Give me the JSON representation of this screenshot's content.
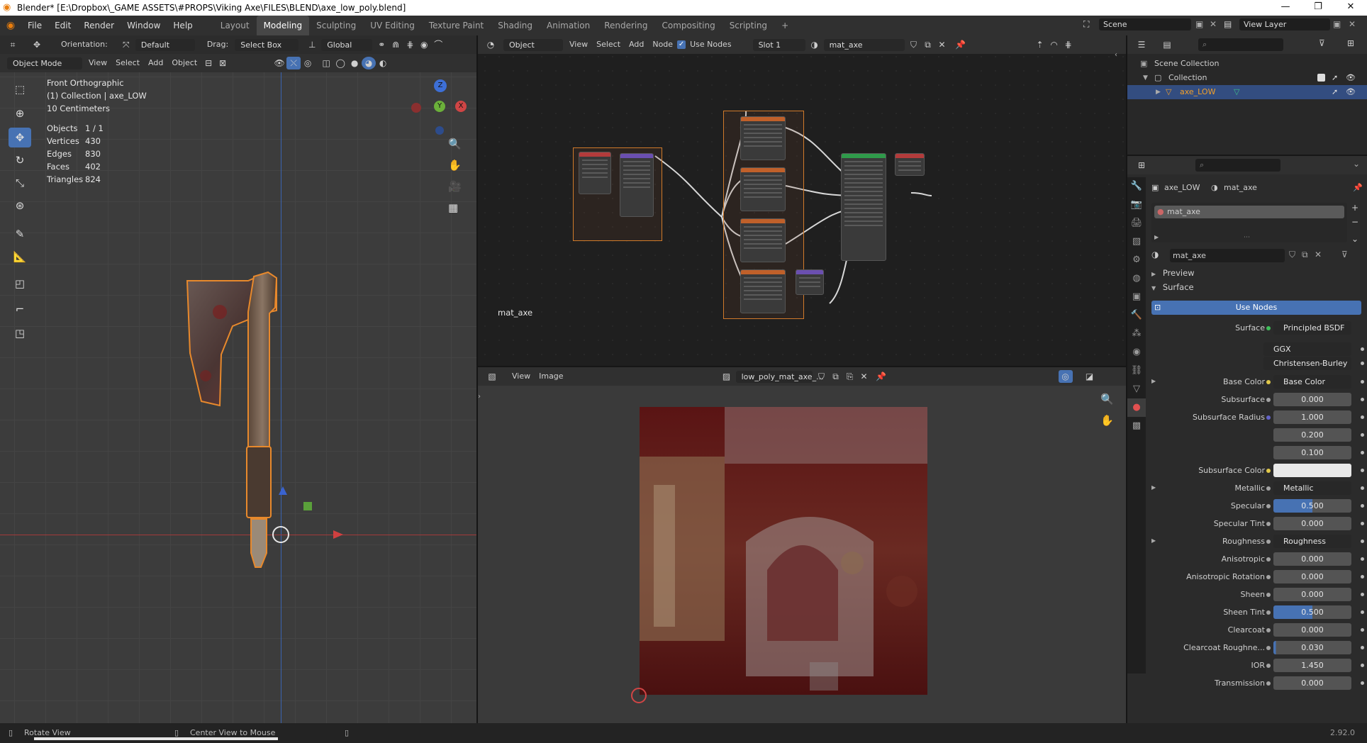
{
  "window": {
    "title": "Blender* [E:\\Dropbox\\_GAME ASSETS\\#PROPS\\Viking Axe\\FILES\\BLEND\\axe_low_poly.blend]",
    "minimize": "—",
    "maximize": "❐",
    "close": "✕"
  },
  "menu": {
    "items": [
      "File",
      "Edit",
      "Render",
      "Window",
      "Help"
    ]
  },
  "workspaces": {
    "tabs": [
      "Layout",
      "Modeling",
      "Sculpting",
      "UV Editing",
      "Texture Paint",
      "Shading",
      "Animation",
      "Rendering",
      "Compositing",
      "Scripting"
    ],
    "active": "Modeling",
    "add": "+"
  },
  "scene": {
    "name": "Scene",
    "view_layer": "View Layer"
  },
  "viewport": {
    "header": {
      "orientation_label": "Orientation:",
      "orientation_value": "Default",
      "drag_label": "Drag:",
      "drag_value": "Select Box",
      "transform_space": "Global",
      "mode": "Object Mode",
      "menus": [
        "View",
        "Select",
        "Add",
        "Object"
      ]
    },
    "overlay": {
      "view_name": "Front Orthographic",
      "collection_line": "(1) Collection | axe_LOW",
      "scale": "10 Centimeters",
      "stats": [
        {
          "label": "Objects",
          "value": "1 / 1"
        },
        {
          "label": "Vertices",
          "value": "430"
        },
        {
          "label": "Edges",
          "value": "830"
        },
        {
          "label": "Faces",
          "value": "402"
        },
        {
          "label": "Triangles",
          "value": "824"
        }
      ]
    },
    "gizmo": {
      "z": "Z",
      "y": "Y",
      "x": "X"
    },
    "tools": [
      "select-box",
      "cursor",
      "move",
      "rotate",
      "scale",
      "transform",
      "annotate",
      "measure",
      "add-cube",
      "extrude",
      "shrink"
    ]
  },
  "node_editor": {
    "header": {
      "type": "Object",
      "menus": [
        "View",
        "Select",
        "Add",
        "Node"
      ],
      "use_nodes_label": "Use Nodes",
      "use_nodes_checked": true,
      "slot": "Slot 1",
      "material": "mat_axe"
    },
    "material_label": "mat_axe"
  },
  "image_editor": {
    "header": {
      "menus": [
        "View",
        "Image"
      ],
      "image_name": "low_poly_mat_axe_..."
    }
  },
  "outliner": {
    "search_placeholder": "",
    "rows": [
      {
        "label": "Scene Collection",
        "indent": 0,
        "selected": false
      },
      {
        "label": "Collection",
        "indent": 1,
        "selected": false
      },
      {
        "label": "axe_LOW",
        "indent": 2,
        "selected": true
      }
    ]
  },
  "properties": {
    "breadcrumb_object": "axe_LOW",
    "breadcrumb_material": "mat_axe",
    "slot_item": "mat_axe",
    "material_name": "mat_axe",
    "panels": {
      "preview": "Preview",
      "surface": "Surface"
    },
    "use_nodes_button": "Use Nodes",
    "surface_label": "Surface",
    "surface_value": "Principled BSDF",
    "distribution": "GGX",
    "subsurface_method": "Christensen-Burley",
    "rows": [
      {
        "label": "Base Color",
        "value": "Base Color",
        "kind": "link",
        "dot": "#e1c84a",
        "expand": true
      },
      {
        "label": "Subsurface",
        "value": "0.000",
        "kind": "num",
        "dot": "#a3a3a3"
      },
      {
        "label": "Subsurface Radius",
        "value": "1.000",
        "kind": "num",
        "dot": "#6363c7"
      },
      {
        "label": "",
        "value": "0.200",
        "kind": "num",
        "dot": ""
      },
      {
        "label": "",
        "value": "0.100",
        "kind": "num",
        "dot": ""
      },
      {
        "label": "Subsurface Color",
        "value": "",
        "kind": "color",
        "dot": "#e1c84a"
      },
      {
        "label": "Metallic",
        "value": "Metallic",
        "kind": "link",
        "dot": "#a3a3a3",
        "expand": true
      },
      {
        "label": "Specular",
        "value": "0.500",
        "kind": "slider",
        "dot": "#a3a3a3"
      },
      {
        "label": "Specular Tint",
        "value": "0.000",
        "kind": "num",
        "dot": "#a3a3a3"
      },
      {
        "label": "Roughness",
        "value": "Roughness",
        "kind": "link",
        "dot": "#a3a3a3",
        "expand": true
      },
      {
        "label": "Anisotropic",
        "value": "0.000",
        "kind": "num",
        "dot": "#a3a3a3"
      },
      {
        "label": "Anisotropic Rotation",
        "value": "0.000",
        "kind": "num",
        "dot": "#a3a3a3"
      },
      {
        "label": "Sheen",
        "value": "0.000",
        "kind": "num",
        "dot": "#a3a3a3"
      },
      {
        "label": "Sheen Tint",
        "value": "0.500",
        "kind": "slider",
        "dot": "#a3a3a3"
      },
      {
        "label": "Clearcoat",
        "value": "0.000",
        "kind": "num",
        "dot": "#a3a3a3"
      },
      {
        "label": "Clearcoat Roughne...",
        "value": "0.030",
        "kind": "slider-small",
        "dot": "#a3a3a3"
      },
      {
        "label": "IOR",
        "value": "1.450",
        "kind": "num",
        "dot": "#a3a3a3"
      },
      {
        "label": "Transmission",
        "value": "0.000",
        "kind": "num",
        "dot": "#a3a3a3"
      }
    ]
  },
  "status": {
    "left_action": "Rotate View",
    "mid_action": "Center View to Mouse",
    "version": "2.92.0"
  },
  "colors": {
    "accent": "#4772b3",
    "frame": "#d07a2a",
    "selection_outline": "#e8892c"
  }
}
